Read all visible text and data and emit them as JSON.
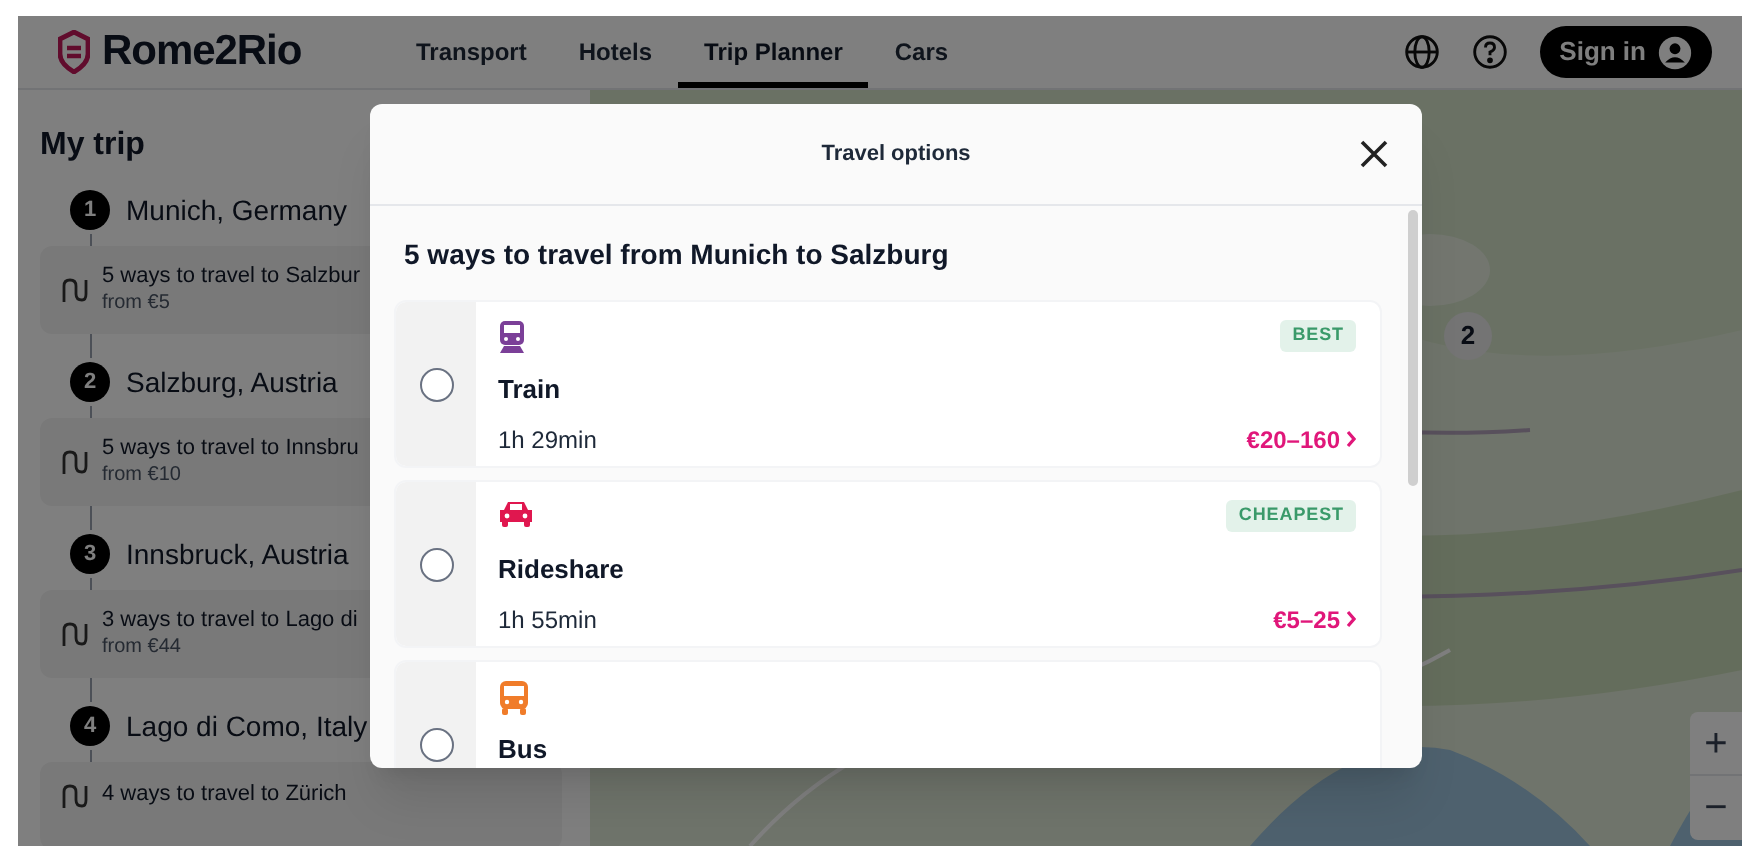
{
  "header": {
    "logo": "Rome2Rio",
    "nav": [
      {
        "label": "Transport",
        "selected": false
      },
      {
        "label": "Hotels",
        "selected": false
      },
      {
        "label": "Trip Planner",
        "selected": true
      },
      {
        "label": "Cars",
        "selected": false
      }
    ],
    "sign_in": "Sign in"
  },
  "sidebar": {
    "title": "My trip",
    "items": [
      {
        "kind": "stop",
        "number": "1",
        "name": "Munich, Germany"
      },
      {
        "kind": "leg",
        "text": "5 ways to travel to Salzbur",
        "price": "from €5"
      },
      {
        "kind": "stop",
        "number": "2",
        "name": "Salzburg, Austria"
      },
      {
        "kind": "leg",
        "text": "5 ways to travel to Innsbru",
        "price": "from €10"
      },
      {
        "kind": "stop",
        "number": "3",
        "name": "Innsbruck, Austria"
      },
      {
        "kind": "leg",
        "text": "3 ways to travel to Lago di",
        "price": "from €44"
      },
      {
        "kind": "stop",
        "number": "4",
        "name": "Lago di Como, Italy"
      },
      {
        "kind": "leg",
        "text": "4 ways to travel to Zürich"
      }
    ]
  },
  "map": {
    "kind": "picture",
    "marker": "2",
    "zoom_in": "+",
    "zoom_out": "−"
  },
  "modal": {
    "title": "Travel options",
    "heading": "5 ways to travel from Munich to Salzburg",
    "options": [
      {
        "kind": "train",
        "name": "Train",
        "duration": "1h 29min",
        "badge": "BEST",
        "price": "€20–160",
        "selected": false
      },
      {
        "kind": "car",
        "name": "Rideshare",
        "duration": "1h 55min",
        "badge": "CHEAPEST",
        "price": "€5–25",
        "selected": false
      },
      {
        "kind": "bus",
        "name": "Bus",
        "selected": false
      }
    ]
  }
}
